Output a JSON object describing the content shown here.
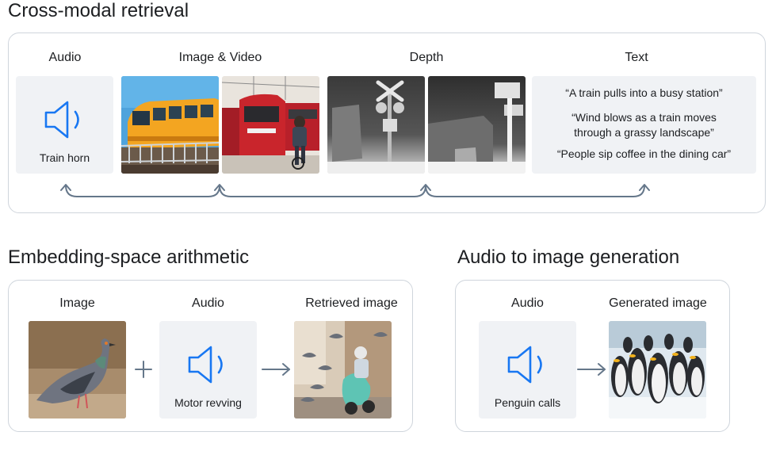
{
  "cross_modal": {
    "title": "Cross-modal retrieval",
    "audio_label": "Audio",
    "image_video_label": "Image & Video",
    "depth_label": "Depth",
    "text_label": "Text",
    "audio_caption": "Train horn",
    "quotes": [
      "“A train pulls into a busy station”",
      "“Wind blows as a train moves through a grassy landscape”",
      "“People sip coffee in the dining car”"
    ]
  },
  "arithmetic": {
    "title": "Embedding-space arithmetic",
    "image_label": "Image",
    "audio_label": "Audio",
    "retrieved_label": "Retrieved image",
    "audio_caption": "Motor revving"
  },
  "generation": {
    "title": "Audio to image generation",
    "audio_label": "Audio",
    "generated_label": "Generated image",
    "audio_caption": "Penguin calls"
  },
  "colors": {
    "accent_blue": "#1877f2",
    "panel_border": "#cfd5dc",
    "card_bg": "#f0f2f5",
    "arrow_gray": "#65778a"
  },
  "icons": [
    "speaker-icon",
    "plus-icon",
    "arrow-right-icon",
    "connector-arrows"
  ]
}
